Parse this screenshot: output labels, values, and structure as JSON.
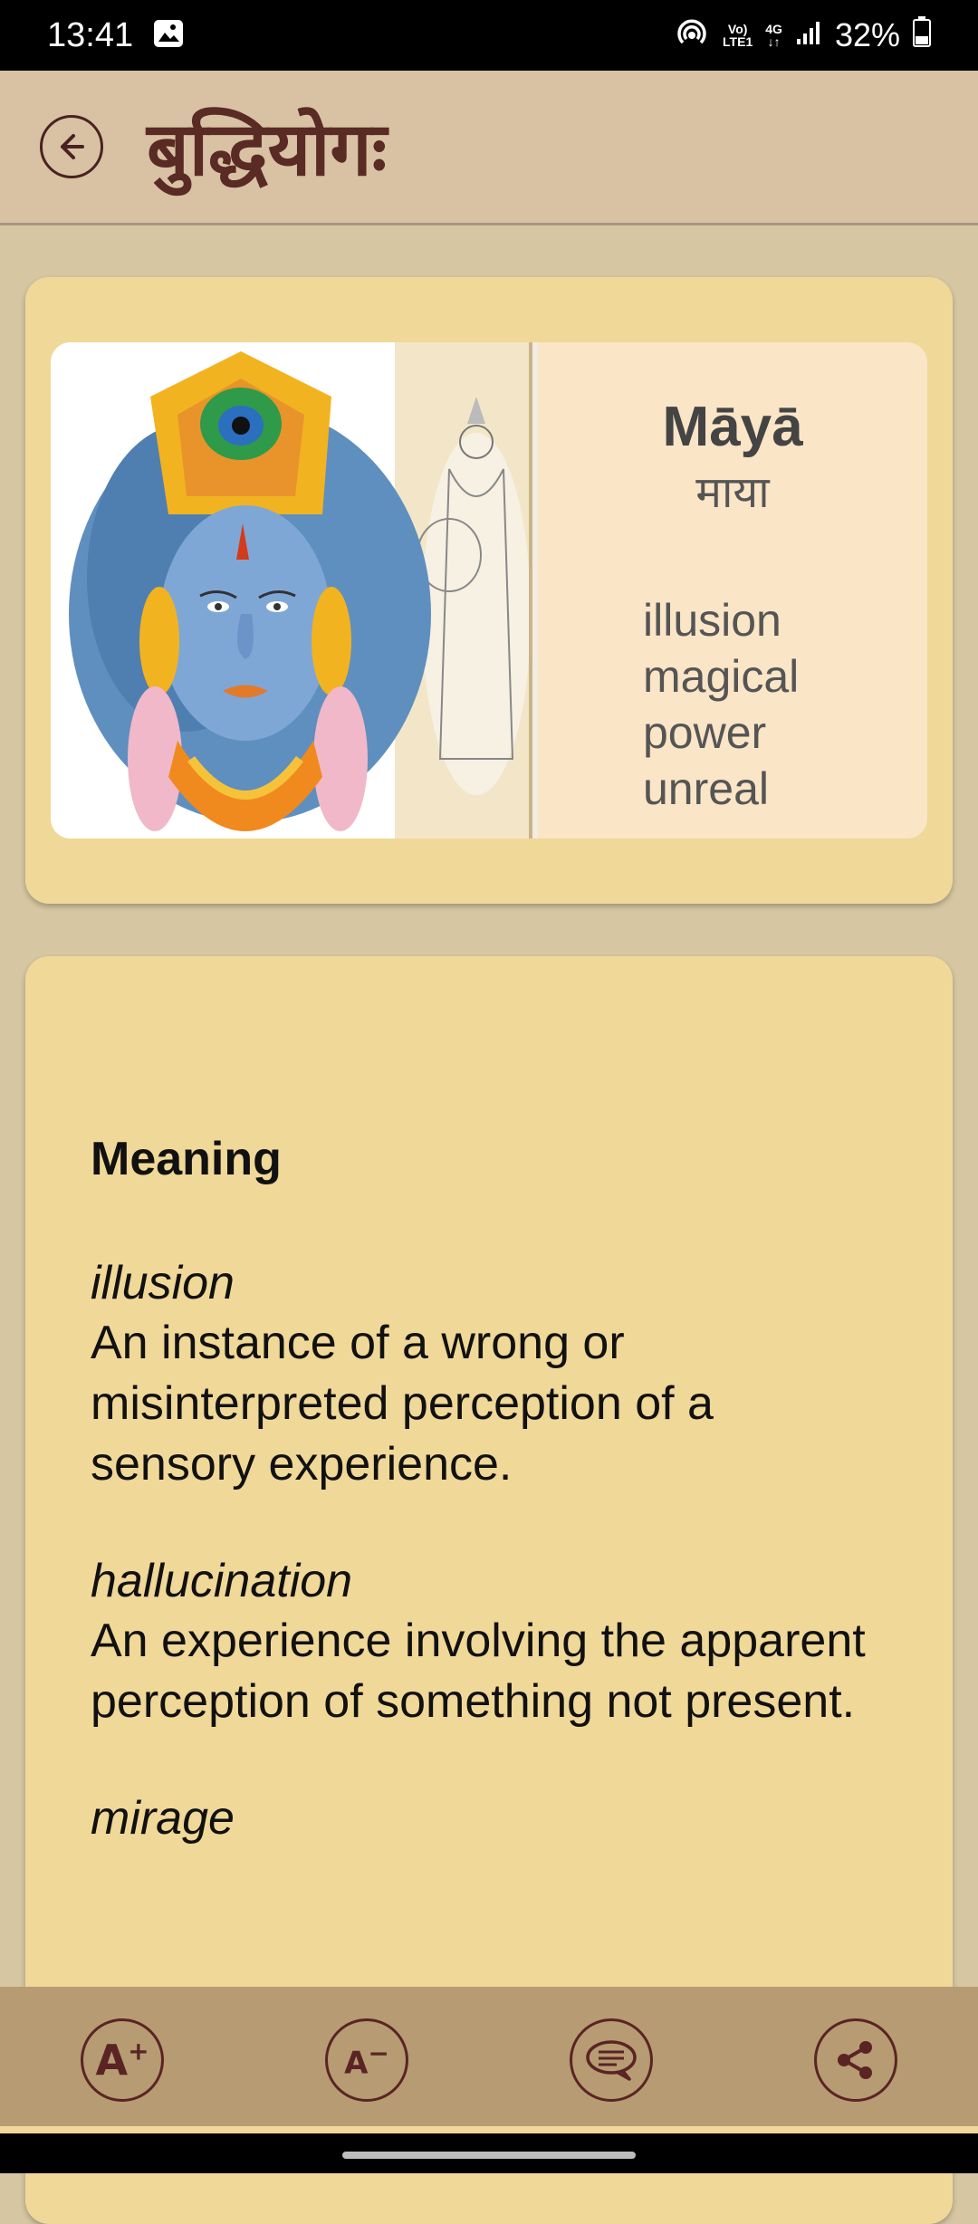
{
  "status_bar": {
    "time": "13:41",
    "network_top": "Vo)",
    "network_bottom": "LTE1",
    "network_type": "4G",
    "battery": "32%"
  },
  "app_bar": {
    "title": "बुद्धियोगः",
    "back_icon": "arrow-left-icon"
  },
  "word_card": {
    "roman": "Māyā",
    "devanagari": "माया",
    "glosses": [
      "illusion",
      "magical power",
      "unreal"
    ]
  },
  "meaning": {
    "heading": "Meaning",
    "entries": [
      {
        "term": "illusion",
        "definition": "An instance of a wrong or misinterpreted perception of a sensory experience."
      },
      {
        "term": "hallucination",
        "definition": "An experience involving the apparent perception of something not present."
      },
      {
        "term": "mirage",
        "definition": ""
      }
    ]
  },
  "toolbar": {
    "increase_font": "A",
    "decrease_font": "A",
    "comment_icon": "chat-bubble-icon",
    "share_icon": "share-icon"
  },
  "colors": {
    "card": "#f0d898",
    "background": "#d6c6a2",
    "app_bar": "#d8c2a3",
    "toolbar": "#b79b73",
    "accent": "#5a2424"
  }
}
